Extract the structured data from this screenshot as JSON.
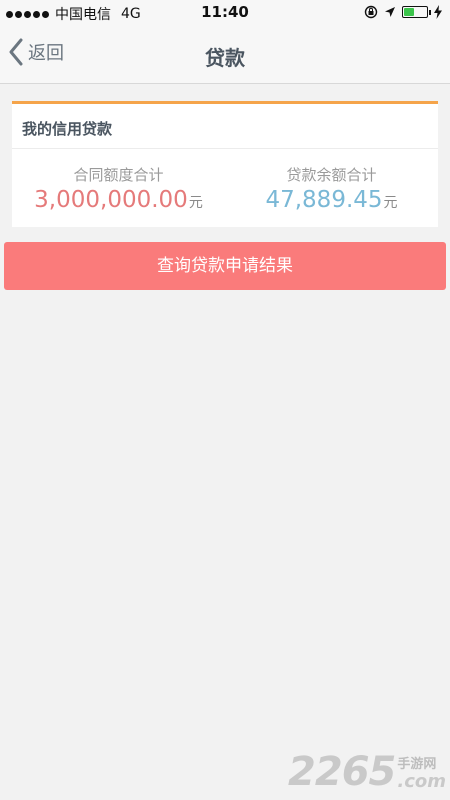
{
  "status_bar": {
    "carrier": "中国电信",
    "network": "4G",
    "time": "11:40",
    "icons": [
      "signal-dots-icon",
      "lock-rotation-icon",
      "location-arrow-icon",
      "battery-icon",
      "charging-bolt-icon"
    ],
    "battery_level": 0.45,
    "battery_color": "#3bc44b"
  },
  "nav": {
    "back_label": "返回",
    "title": "贷款"
  },
  "credit_card": {
    "title": "我的信用贷款",
    "accent_color": "#f5a44a",
    "contract_total": {
      "label": "合同额度合计",
      "value": "3,000,000.00",
      "unit": "元",
      "color": "#e57a7a"
    },
    "loan_balance": {
      "label": "贷款余额合计",
      "value": "47,889.45",
      "unit": "元",
      "color": "#7ab8d6"
    }
  },
  "query_button": {
    "label": "查询贷款申请结果",
    "color": "#fa7b7b"
  },
  "watermark": {
    "number": "2265",
    "chinese": "手游网",
    "suffix": ".com"
  }
}
